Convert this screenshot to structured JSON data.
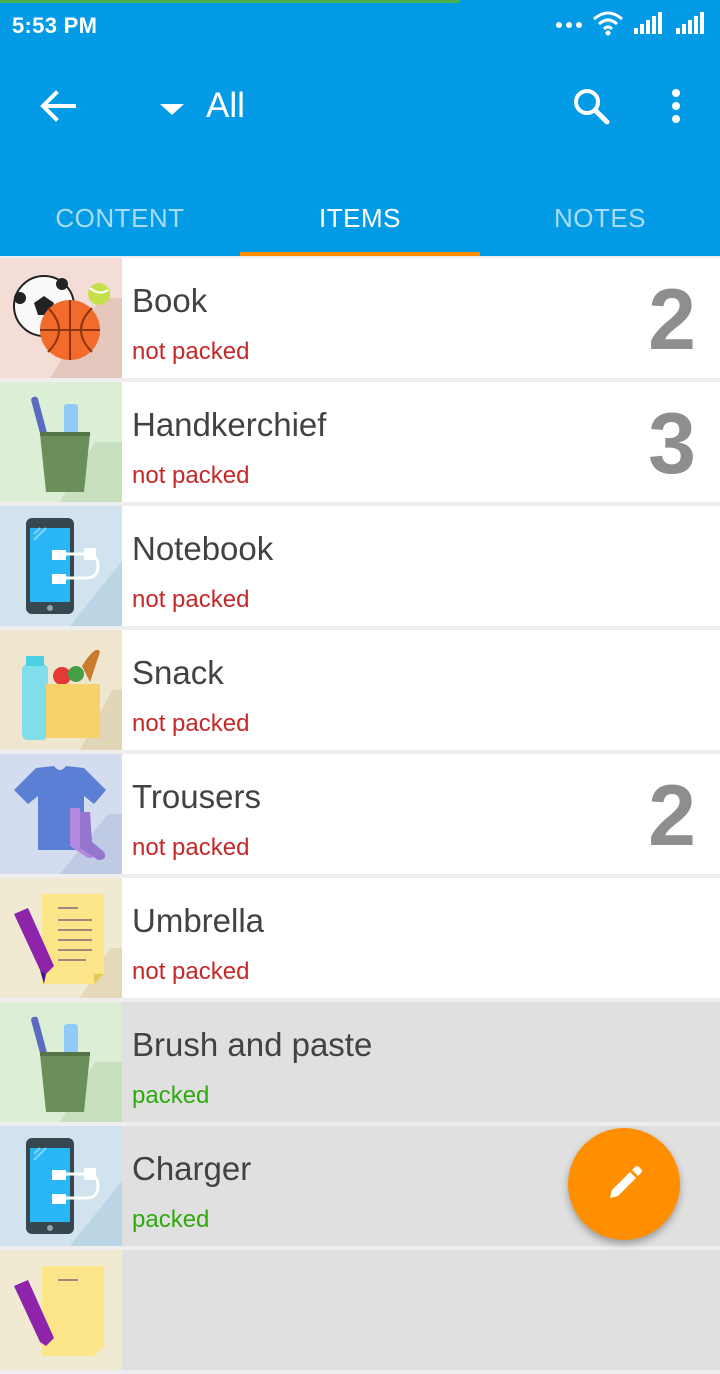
{
  "status_bar": {
    "time": "5:53 PM",
    "progress": 0.64
  },
  "app_bar": {
    "title": "All"
  },
  "tabs": [
    {
      "label": "CONTENT",
      "active": false
    },
    {
      "label": "ITEMS",
      "active": true
    },
    {
      "label": "NOTES",
      "active": false
    }
  ],
  "items": [
    {
      "name": "Book",
      "status": "not packed",
      "quantity": "2",
      "icon": "sports-balls-icon"
    },
    {
      "name": "Handkerchief",
      "status": "not packed",
      "quantity": "3",
      "icon": "toothbrush-cup-icon"
    },
    {
      "name": "Notebook",
      "status": "not packed",
      "quantity": "",
      "icon": "phone-charger-icon"
    },
    {
      "name": "Snack",
      "status": "not packed",
      "quantity": "",
      "icon": "groceries-bag-icon"
    },
    {
      "name": "Trousers",
      "status": "not packed",
      "quantity": "2",
      "icon": "clothes-icon"
    },
    {
      "name": "Umbrella",
      "status": "not packed",
      "quantity": "",
      "icon": "notepad-pen-icon"
    },
    {
      "name": "Brush and paste",
      "status": "packed",
      "quantity": "",
      "icon": "toothbrush-cup-icon"
    },
    {
      "name": "Charger",
      "status": "packed",
      "quantity": "",
      "icon": "phone-charger-icon"
    }
  ],
  "colors": {
    "primary": "#039be5",
    "accent": "#ff8f00",
    "not_packed": "#c62828",
    "packed": "#2eaa0e"
  }
}
